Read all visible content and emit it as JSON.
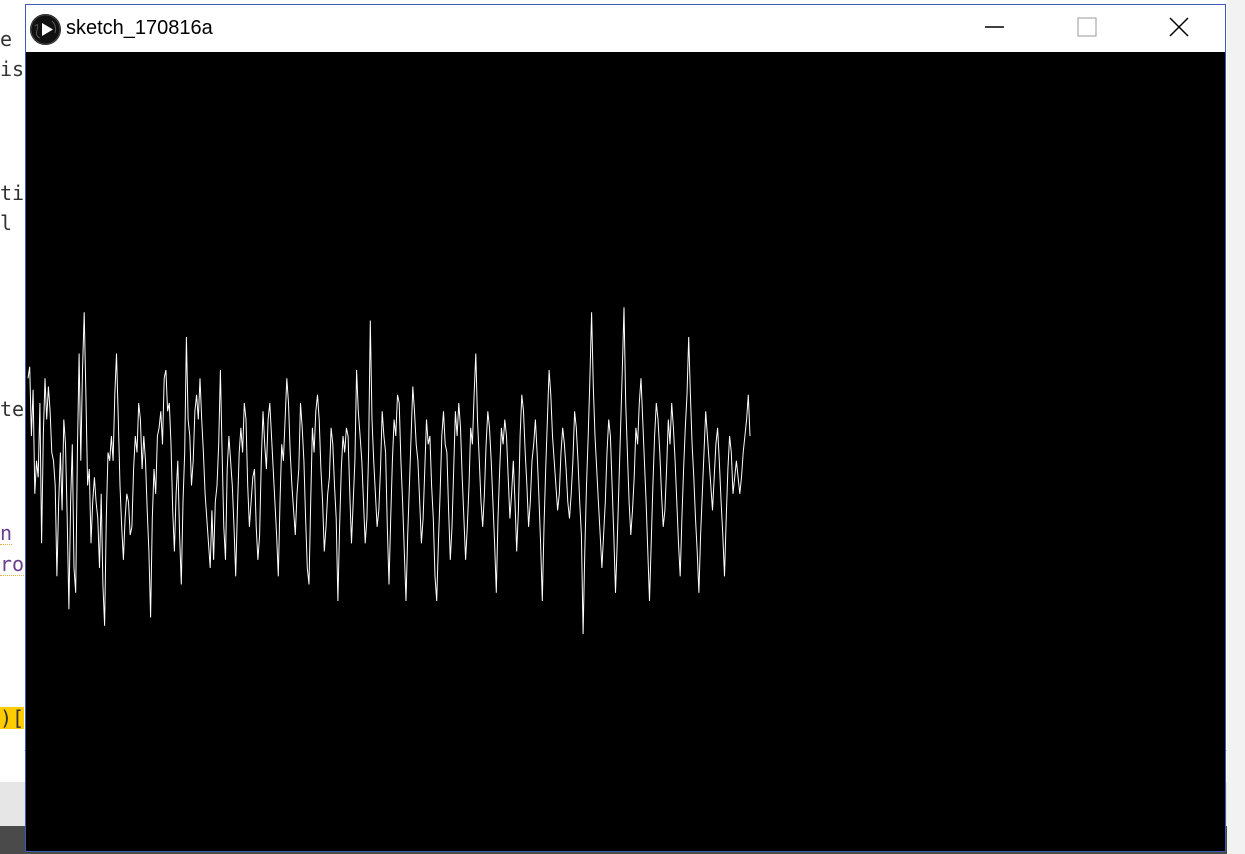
{
  "window": {
    "title": "sketch_170816a",
    "icon": "processing-play-icon",
    "controls": [
      "minimize-icon",
      "maximize-icon",
      "close-icon"
    ]
  },
  "canvas": {
    "background": "#000000",
    "stroke": "#ffffff"
  },
  "waveform": {
    "samples": [
      0.55,
      0.62,
      0.2,
      0.48,
      -0.15,
      0.05,
      -0.05,
      0.4,
      -0.45,
      0.2,
      0.55,
      0.3,
      0.5,
      0.35,
      0.1,
      0.05,
      -0.1,
      -0.65,
      -0.2,
      0.1,
      -0.25,
      0.3,
      0.15,
      -0.3,
      -0.85,
      -0.2,
      0.15,
      -0.6,
      -0.75,
      0.1,
      0.7,
      0.05,
      0.6,
      0.95,
      0.45,
      -0.1,
      0.0,
      -0.45,
      -0.2,
      -0.05,
      -0.2,
      -0.3,
      -0.6,
      -0.15,
      -0.7,
      -0.95,
      -0.3,
      0.1,
      0.05,
      0.2,
      0.05,
      0.45,
      0.7,
      0.3,
      -0.1,
      -0.35,
      -0.55,
      -0.3,
      -0.15,
      -0.2,
      -0.4,
      -0.35,
      0.0,
      0.2,
      0.1,
      0.4,
      0.3,
      0.0,
      0.2,
      0.05,
      -0.25,
      -0.5,
      -0.9,
      -0.3,
      0.0,
      -0.15,
      0.2,
      0.25,
      0.35,
      0.15,
      0.55,
      0.6,
      0.35,
      0.4,
      0.15,
      -0.25,
      -0.5,
      -0.15,
      0.05,
      -0.4,
      -0.7,
      -0.2,
      0.1,
      0.8,
      0.3,
      0.2,
      -0.1,
      0.05,
      0.35,
      0.45,
      0.3,
      0.55,
      0.3,
      0.1,
      -0.15,
      -0.3,
      -0.45,
      -0.6,
      -0.25,
      -0.55,
      -0.2,
      -0.1,
      0.15,
      0.6,
      0.1,
      -0.35,
      -0.55,
      0.0,
      0.2,
      0.05,
      -0.1,
      -0.35,
      -0.65,
      -0.25,
      0.1,
      0.25,
      0.1,
      0.4,
      0.3,
      -0.1,
      -0.35,
      -0.2,
      -0.05,
      0.0,
      -0.35,
      -0.55,
      -0.4,
      0.05,
      0.35,
      0.15,
      0.0,
      0.3,
      0.4,
      0.2,
      0.0,
      -0.2,
      -0.4,
      -0.65,
      -0.2,
      0.15,
      0.05,
      0.3,
      0.55,
      0.4,
      0.1,
      -0.1,
      -0.25,
      -0.4,
      -0.15,
      0.0,
      0.4,
      0.25,
      0.05,
      -0.3,
      -0.6,
      -0.7,
      -0.2,
      0.25,
      0.1,
      0.35,
      0.45,
      0.3,
      0.0,
      -0.2,
      -0.5,
      -0.35,
      -0.15,
      -0.05,
      0.25,
      0.15,
      -0.1,
      -0.3,
      -0.8,
      -0.35,
      0.0,
      0.2,
      0.1,
      0.25,
      0.2,
      -0.15,
      -0.45,
      -0.2,
      0.05,
      0.6,
      0.35,
      0.2,
      0.05,
      -0.2,
      -0.45,
      -0.3,
      0.1,
      0.9,
      0.3,
      0.05,
      -0.15,
      -0.35,
      -0.25,
      0.0,
      0.35,
      0.2,
      0.1,
      -0.35,
      -0.7,
      -0.3,
      0.05,
      0.3,
      0.2,
      0.45,
      0.4,
      0.05,
      -0.2,
      -0.5,
      -0.8,
      -0.4,
      -0.1,
      0.2,
      0.5,
      0.35,
      0.15,
      0.05,
      -0.2,
      -0.45,
      -0.3,
      0.0,
      0.3,
      0.15,
      0.2,
      -0.1,
      -0.3,
      -0.65,
      -0.8,
      -0.45,
      -0.15,
      0.2,
      0.35,
      0.15,
      0.1,
      -0.25,
      -0.55,
      -0.35,
      0.0,
      0.35,
      0.2,
      0.4,
      0.25,
      -0.05,
      -0.3,
      -0.55,
      -0.35,
      -0.1,
      0.25,
      0.15,
      0.45,
      0.7,
      0.3,
      0.05,
      -0.2,
      -0.35,
      -0.15,
      0.15,
      0.35,
      0.25,
      0.05,
      -0.2,
      -0.45,
      -0.75,
      -0.3,
      0.0,
      0.25,
      0.15,
      0.3,
      0.2,
      -0.05,
      -0.3,
      -0.15,
      0.05,
      -0.2,
      -0.5,
      -0.25,
      0.2,
      0.45,
      0.35,
      0.1,
      -0.1,
      -0.35,
      -0.2,
      0.05,
      0.15,
      0.3,
      0.1,
      -0.15,
      -0.45,
      -0.8,
      -0.35,
      0.0,
      0.3,
      0.6,
      0.45,
      0.2,
      0.05,
      -0.1,
      -0.25,
      -0.15,
      0.1,
      0.25,
      0.15,
      0.0,
      -0.2,
      -0.3,
      -0.15,
      0.05,
      0.35,
      0.25,
      0.05,
      -0.2,
      -0.4,
      -1.0,
      -0.5,
      -0.1,
      0.2,
      0.55,
      0.95,
      0.5,
      0.2,
      0.0,
      -0.2,
      -0.4,
      -0.6,
      -0.4,
      -0.2,
      0.1,
      0.3,
      0.2,
      -0.1,
      -0.4,
      -0.75,
      -0.45,
      -0.1,
      0.25,
      0.6,
      0.98,
      0.4,
      0.1,
      -0.2,
      -0.4,
      -0.25,
      -0.05,
      0.25,
      0.15,
      0.4,
      0.55,
      0.3,
      0.05,
      -0.2,
      -0.5,
      -0.8,
      -0.45,
      -0.1,
      0.2,
      0.4,
      0.3,
      0.1,
      -0.15,
      -0.35,
      -0.25,
      0.0,
      0.3,
      0.15,
      0.4,
      0.25,
      0.05,
      -0.2,
      -0.45,
      -0.65,
      -0.3,
      0.0,
      0.25,
      0.45,
      0.8,
      0.45,
      0.15,
      -0.05,
      -0.3,
      -0.5,
      -0.75,
      -0.4,
      -0.15,
      0.1,
      0.35,
      0.2,
      0.05,
      -0.1,
      -0.25,
      -0.05,
      0.15,
      0.25,
      0.05,
      -0.2,
      -0.4,
      -0.65,
      -0.3,
      0.0,
      0.2,
      0.1,
      -0.15,
      -0.05,
      0.05,
      -0.05,
      -0.15,
      -0.05,
      0.1,
      0.2,
      0.3,
      0.45,
      0.2
    ]
  }
}
